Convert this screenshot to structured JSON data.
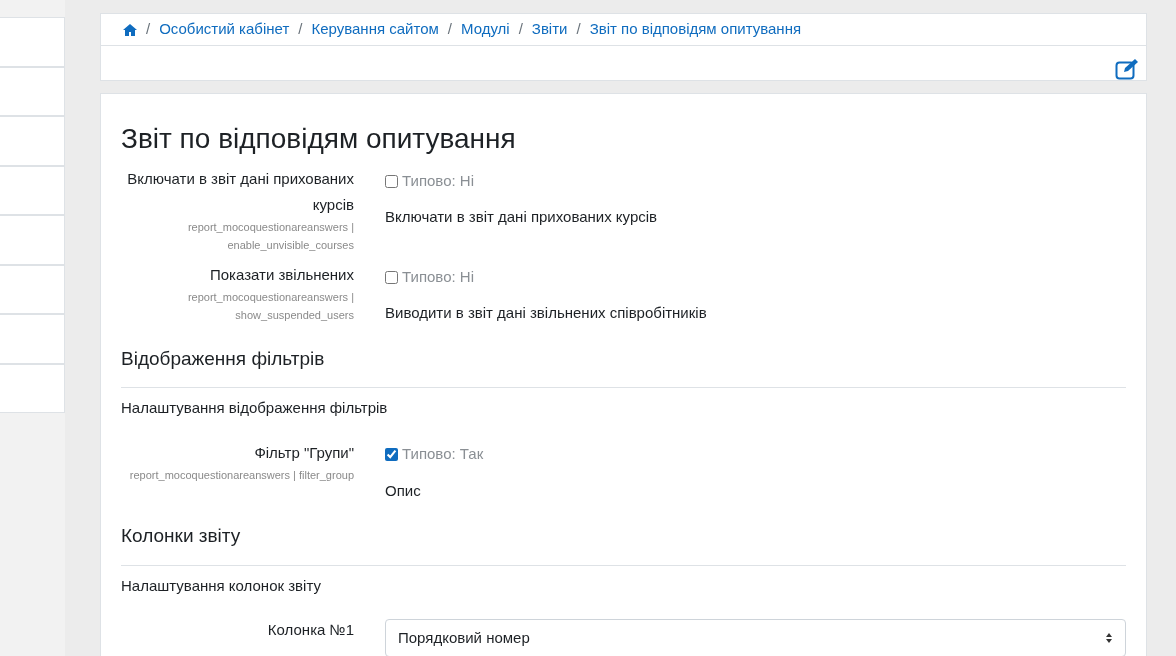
{
  "breadcrumb": [
    {
      "separator": "/",
      "label": "Особистий кабінет"
    },
    {
      "separator": "/",
      "label": "Керування сайтом"
    },
    {
      "separator": "/",
      "label": "Модулі"
    },
    {
      "separator": "/",
      "label": "Звіти"
    },
    {
      "separator": "/",
      "label": "Звіт по відповідям опитування"
    }
  ],
  "page_title": "Звіт по відповідям опитування",
  "sections": [
    {
      "settings": [
        {
          "kind": "checkbox",
          "label": "Включати в звіт дані прихованих курсів",
          "keys": [
            "report_mocoquestionareanswers |",
            "enable_unvisible_courses"
          ],
          "checked": false,
          "default": "Типово: Ні",
          "description": "Включати в звіт дані прихованих курсів"
        },
        {
          "kind": "checkbox",
          "label": "Показати звільнених",
          "keys": [
            "report_mocoquestionareanswers |",
            "show_suspended_users"
          ],
          "checked": false,
          "default": "Типово: Ні",
          "description": "Виводити в звіт дані звільнених співробітників"
        }
      ]
    },
    {
      "heading": "Відображення фільтрів",
      "intro": "Налаштування відображення фільтрів",
      "settings": [
        {
          "kind": "checkbox",
          "label": "Фільтр \"Групи\"",
          "keys": [
            "report_mocoquestionareanswers | filter_group"
          ],
          "checked": true,
          "default": "Типово: Так",
          "description": "Опис"
        }
      ]
    },
    {
      "heading": "Колонки звіту",
      "intro": "Налаштування колонок звіту",
      "settings": [
        {
          "kind": "select",
          "label": "Колонка №1",
          "value": "Порядковий номер"
        }
      ]
    }
  ]
}
